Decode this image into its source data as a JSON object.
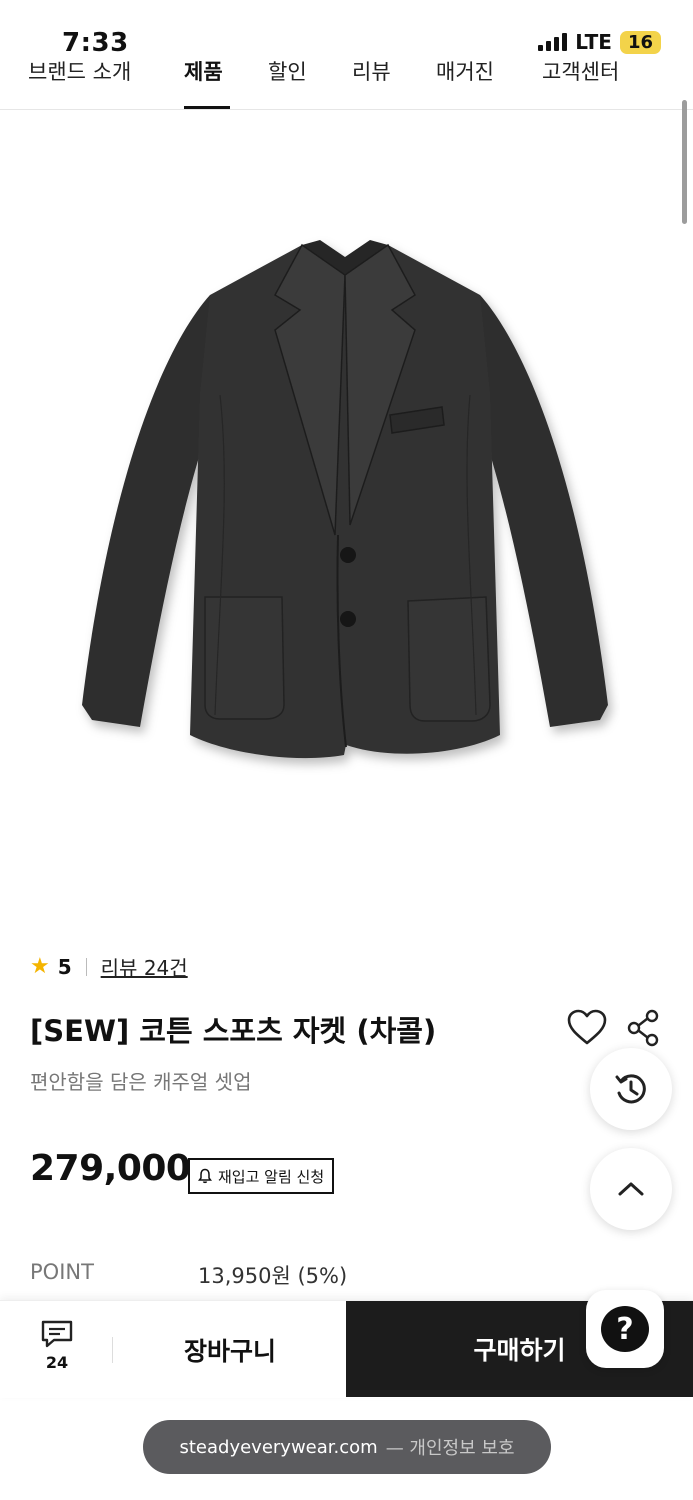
{
  "status_bar": {
    "time": "7:33",
    "network": "LTE",
    "battery": "16"
  },
  "top_nav": {
    "tabs": [
      {
        "label": "브랜드 소개",
        "active": false
      },
      {
        "label": "제품",
        "active": true
      },
      {
        "label": "할인",
        "active": false
      },
      {
        "label": "리뷰",
        "active": false
      },
      {
        "label": "매거진",
        "active": false
      },
      {
        "label": "고객센터",
        "active": false
      }
    ]
  },
  "product": {
    "rating": "5",
    "reviews_link": "리뷰 24건",
    "title": "[SEW] 코튼 스포츠 자켓 (차콜)",
    "subtitle": "편안함을 담은 캐주얼 셋업",
    "price": "279,000",
    "restock_button": "재입고 알림 신청",
    "point_label": "POINT",
    "point_value": "13,950원 (5%)",
    "image_color": "#2e2e2e"
  },
  "bottom_bar": {
    "review_count": "24",
    "cart_label": "장바구니",
    "buy_label": "구매하기"
  },
  "url_bar": {
    "domain": "steadyeverywear.com",
    "note": "— 개인정보 보호"
  },
  "icons": {
    "rating": "star-icon",
    "wishlist": "heart-icon",
    "share": "share-icon",
    "history": "history-icon",
    "scroll_top": "chevron-up-icon",
    "review": "chat-icon",
    "help": "question-icon",
    "restock": "bell-icon"
  }
}
